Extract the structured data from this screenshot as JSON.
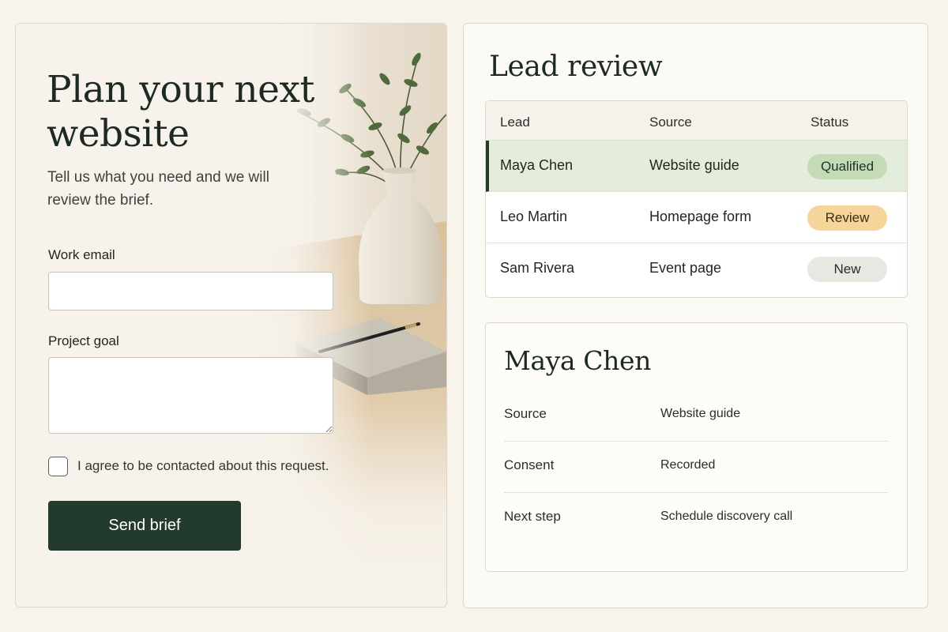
{
  "form": {
    "title": "Plan your next website",
    "subtitle": "Tell us what you need and we will review the brief.",
    "email_label": "Work email",
    "email_value": "",
    "goal_label": "Project goal",
    "goal_value": "",
    "consent_label": "I agree to be contacted about this request.",
    "consent_checked": false,
    "submit_label": "Send brief"
  },
  "review": {
    "title": "Lead review",
    "columns": [
      "Lead",
      "Source",
      "Status"
    ],
    "rows": [
      {
        "lead": "Maya Chen",
        "source": "Website guide",
        "status": "Qualified",
        "selected": true
      },
      {
        "lead": "Leo Martin",
        "source": "Homepage form",
        "status": "Review",
        "selected": false
      },
      {
        "lead": "Sam Rivera",
        "source": "Event page",
        "status": "New",
        "selected": false
      }
    ]
  },
  "detail": {
    "name": "Maya Chen",
    "fields": [
      {
        "label": "Source",
        "value": "Website guide"
      },
      {
        "label": "Consent",
        "value": "Recorded"
      },
      {
        "label": "Next step",
        "value": "Schedule discovery call"
      }
    ]
  },
  "colors": {
    "accent": "#233b2c",
    "qualified": "#c4dbb5",
    "review": "#f6d59a",
    "new": "#e9e7e2",
    "selected_row": "#e4ecdc"
  }
}
